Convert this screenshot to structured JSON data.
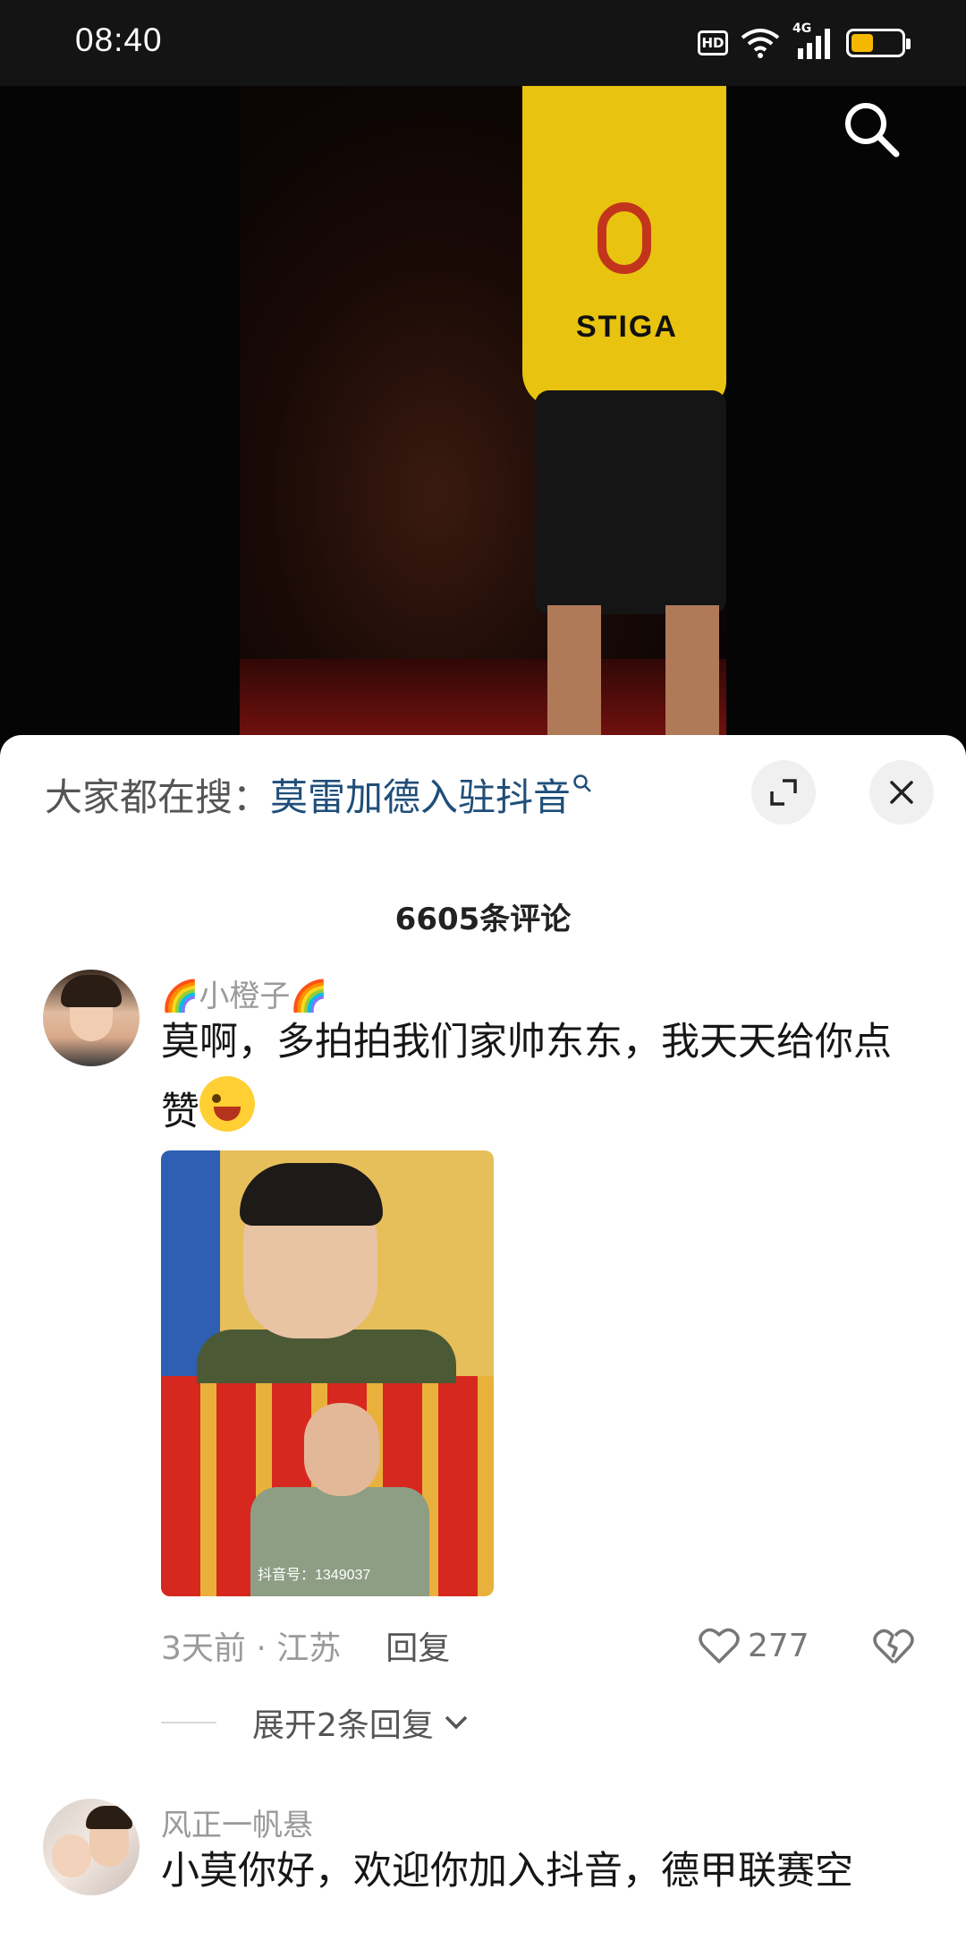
{
  "status_bar": {
    "time": "08:40",
    "hd_label": "HD",
    "network_label": "4G",
    "battery_level": 0.45,
    "battery_color": "#f5b800"
  },
  "video": {
    "shirt_text": "STIGA",
    "search_icon": "search-icon"
  },
  "comment_sheet": {
    "trending_lead": "大家都在搜：",
    "trending_keyword": "莫雷加德入驻抖音",
    "expand_icon": "expand-icon",
    "close_icon": "close-icon",
    "count_label": "6605条评论",
    "comments": [
      {
        "username": "🌈小橙子🌈",
        "text": "莫啊，多拍拍我们家帅东东，我天天给你点赞",
        "image_watermark": "抖音号：1349037",
        "time_location": "3天前 · 江苏",
        "reply_label": "回复",
        "likes": "277",
        "expand_replies": "展开2条回复"
      },
      {
        "username": "风正一帆悬",
        "text": "小莫你好，欢迎你加入抖音，德甲联赛空"
      }
    ]
  }
}
